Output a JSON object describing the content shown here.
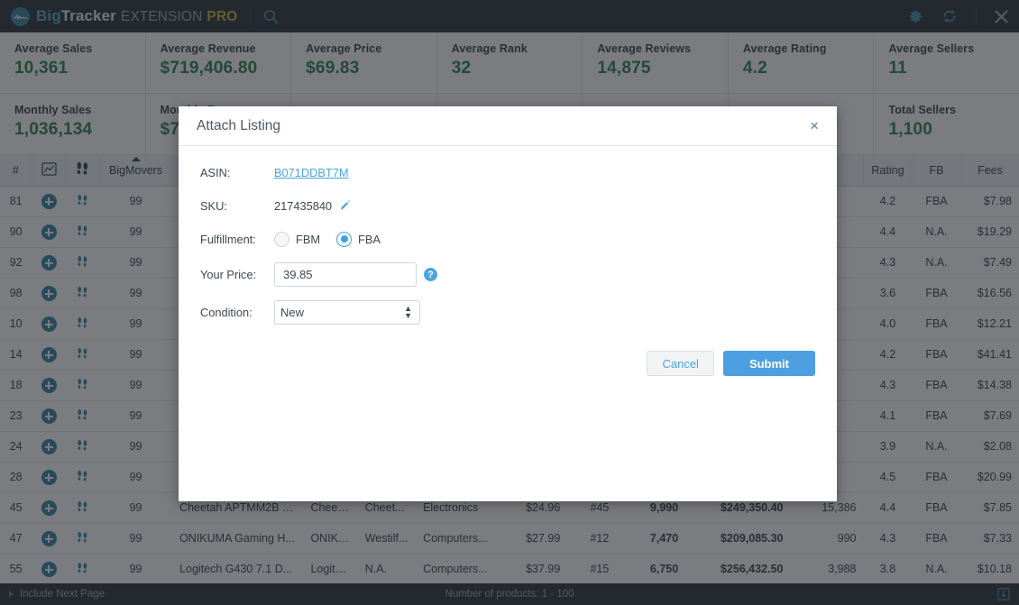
{
  "titlebar": {
    "brand_big": "Big",
    "brand_tracker": "Tracker",
    "brand_extension": "EXTENSION",
    "brand_pro": "PRO",
    "search_icon": "search-icon",
    "settings_icon": "gear-icon",
    "refresh_icon": "refresh-icon",
    "close_icon": "close-icon"
  },
  "stats": {
    "row1": [
      {
        "label": "Average Sales",
        "value": "10,361"
      },
      {
        "label": "Average Revenue",
        "value": "$719,406.80"
      },
      {
        "label": "Average Price",
        "value": "$69.83"
      },
      {
        "label": "Average Rank",
        "value": "32"
      },
      {
        "label": "Average Reviews",
        "value": "14,875"
      },
      {
        "label": "Average Rating",
        "value": "4.2"
      },
      {
        "label": "Average Sellers",
        "value": "11"
      }
    ],
    "row2": [
      {
        "label": "Monthly Sales",
        "value": "1,036,134"
      },
      {
        "label": "Monthly Revenue",
        "value": "$7"
      },
      {
        "label": "",
        "value": ""
      },
      {
        "label": "",
        "value": ""
      },
      {
        "label": "",
        "value": ""
      },
      {
        "label": "",
        "value": ""
      },
      {
        "label": "Total Sellers",
        "value": "1,100"
      }
    ]
  },
  "table": {
    "columns": [
      {
        "key": "num",
        "label": "#",
        "name": "column-index"
      },
      {
        "key": "add",
        "label": "",
        "name": "column-chart-icon"
      },
      {
        "key": "track",
        "label": "",
        "name": "column-footprint-icon"
      },
      {
        "key": "bm",
        "label": "BigMovers",
        "name": "column-bigmovers",
        "sorted": true
      },
      {
        "key": "title",
        "label": "",
        "name": "column-title"
      },
      {
        "key": "brand",
        "label": "",
        "name": "column-brand"
      },
      {
        "key": "seller",
        "label": "",
        "name": "column-seller"
      },
      {
        "key": "cat",
        "label": "",
        "name": "column-category"
      },
      {
        "key": "price",
        "label": "",
        "name": "column-price"
      },
      {
        "key": "rank",
        "label": "",
        "name": "column-rank"
      },
      {
        "key": "sales",
        "label": "",
        "name": "column-sales"
      },
      {
        "key": "rev",
        "label": "",
        "name": "column-revenue"
      },
      {
        "key": "rev2",
        "label": "",
        "name": "column-reviews"
      },
      {
        "key": "rating",
        "label": "Rating",
        "name": "column-rating"
      },
      {
        "key": "fb",
        "label": "FB",
        "name": "column-fb"
      },
      {
        "key": "fees",
        "label": "Fees",
        "name": "column-fees"
      }
    ],
    "rows": [
      {
        "num": "81",
        "bm": "99",
        "title": "",
        "brand": "",
        "seller": "",
        "cat": "",
        "price": "",
        "rank": "",
        "sales": "",
        "rev": "",
        "rev2": "",
        "rating": "4.2",
        "fb": "FBA",
        "fees": "$7.98"
      },
      {
        "num": "90",
        "bm": "99",
        "title": "",
        "brand": "",
        "seller": "",
        "cat": "",
        "price": "",
        "rank": "",
        "sales": "",
        "rev": "",
        "rev2": "",
        "rating": "4.4",
        "fb": "N.A.",
        "fees": "$19.29"
      },
      {
        "num": "92",
        "bm": "99",
        "title": "",
        "brand": "",
        "seller": "",
        "cat": "",
        "price": "",
        "rank": "",
        "sales": "",
        "rev": "",
        "rev2": "",
        "rating": "4.3",
        "fb": "N.A.",
        "fees": "$7.49"
      },
      {
        "num": "98",
        "bm": "99",
        "title": "",
        "brand": "",
        "seller": "",
        "cat": "",
        "price": "",
        "rank": "",
        "sales": "",
        "rev": "",
        "rev2": "",
        "rating": "3.6",
        "fb": "FBA",
        "fees": "$16.56"
      },
      {
        "num": "10",
        "bm": "99",
        "title": "",
        "brand": "",
        "seller": "",
        "cat": "",
        "price": "",
        "rank": "",
        "sales": "",
        "rev": "",
        "rev2": "",
        "rating": "4.0",
        "fb": "FBA",
        "fees": "$12.21"
      },
      {
        "num": "14",
        "bm": "99",
        "title": "",
        "brand": "",
        "seller": "",
        "cat": "",
        "price": "",
        "rank": "",
        "sales": "",
        "rev": "",
        "rev2": "",
        "rating": "4.2",
        "fb": "FBA",
        "fees": "$41.41"
      },
      {
        "num": "18",
        "bm": "99",
        "title": "",
        "brand": "",
        "seller": "",
        "cat": "",
        "price": "",
        "rank": "",
        "sales": "",
        "rev": "",
        "rev2": "",
        "rating": "4.3",
        "fb": "FBA",
        "fees": "$14.38"
      },
      {
        "num": "23",
        "bm": "99",
        "title": "",
        "brand": "",
        "seller": "",
        "cat": "",
        "price": "",
        "rank": "",
        "sales": "",
        "rev": "",
        "rev2": "",
        "rating": "4.1",
        "fb": "FBA",
        "fees": "$7.69"
      },
      {
        "num": "24",
        "bm": "99",
        "title": "",
        "brand": "",
        "seller": "",
        "cat": "",
        "price": "",
        "rank": "",
        "sales": "",
        "rev": "",
        "rev2": "",
        "rating": "3.9",
        "fb": "N.A.",
        "fees": "$2.08"
      },
      {
        "num": "28",
        "bm": "99",
        "title": "",
        "brand": "",
        "seller": "",
        "cat": "",
        "price": "",
        "rank": "",
        "sales": "",
        "rev": "",
        "rev2": "",
        "rating": "4.5",
        "fb": "FBA",
        "fees": "$20.99"
      },
      {
        "num": "45",
        "bm": "99",
        "title": "Cheetah APTMM2B T...",
        "brand": "Cheetah",
        "seller": "Cheet...",
        "cat": "Electronics",
        "price": "$24.96",
        "rank": "#45",
        "sales": "9,990",
        "rev": "$249,350.40",
        "rev2": "15,386",
        "rating": "4.4",
        "fb": "FBA",
        "fees": "$7.85"
      },
      {
        "num": "47",
        "bm": "99",
        "title": "ONIKUMA Gaming H...",
        "brand": "ONIKU...",
        "seller": "Westilf...",
        "cat": "Computers...",
        "price": "$27.99",
        "rank": "#12",
        "sales": "7,470",
        "rev": "$209,085.30",
        "rev2": "990",
        "rating": "4.3",
        "fb": "FBA",
        "fees": "$7.33"
      },
      {
        "num": "55",
        "bm": "99",
        "title": "Logitech G430 7.1 D...",
        "brand": "Logitech",
        "seller": "N.A.",
        "cat": "Computers...",
        "price": "$37.99",
        "rank": "#15",
        "sales": "6,750",
        "rev": "$256,432.50",
        "rev2": "3,988",
        "rating": "3.8",
        "fb": "N.A.",
        "fees": "$10.18"
      }
    ]
  },
  "footer": {
    "include_next_page": "Include Next Page",
    "product_count": "Number of products: 1 - 100",
    "download_icon": "download-icon"
  },
  "modal": {
    "title": "Attach Listing",
    "close_label": "×",
    "asin_label": "ASIN:",
    "asin_value": "B071DDBT7M",
    "sku_label": "SKU:",
    "sku_value": "217435840",
    "edit_icon": "pencil-icon",
    "fulfillment_label": "Fulfillment:",
    "fulfillment_options": [
      "FBM",
      "FBA"
    ],
    "fulfillment_selected": "FBA",
    "price_label": "Your Price:",
    "price_value": "39.85",
    "price_placeholder": "",
    "help_icon_label": "?",
    "condition_label": "Condition:",
    "condition_value": "New",
    "condition_options": [
      "New"
    ],
    "cancel_label": "Cancel",
    "submit_label": "Submit"
  },
  "colors": {
    "brand_blue": "#4aa6c7",
    "brand_gold": "#c8ae2e",
    "titlebar_bg": "#1d2531",
    "stat_green": "#1e7a44",
    "link_blue": "#2c7ba0",
    "accent_blue": "#4aa6dd",
    "submit_blue": "#4c9fe0"
  }
}
